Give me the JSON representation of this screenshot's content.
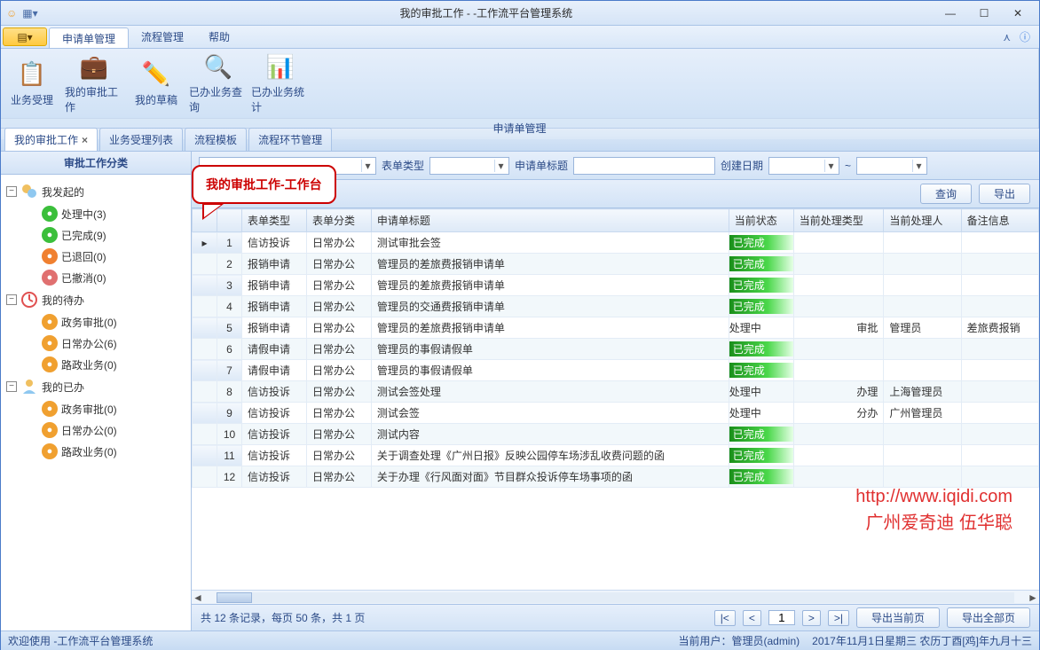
{
  "window": {
    "title": "我的审批工作 - -工作流平台管理系统"
  },
  "menu": {
    "file_icon": "▤▾",
    "items": [
      "申请单管理",
      "流程管理",
      "帮助"
    ],
    "active": 0
  },
  "ribbon": {
    "group_label": "申请单管理",
    "items": [
      "业务受理",
      "我的审批工作",
      "我的草稿",
      "已办业务查询",
      "已办业务统计"
    ]
  },
  "doc_tabs": [
    {
      "label": "我的审批工作",
      "active": true,
      "closable": true
    },
    {
      "label": "业务受理列表",
      "active": false
    },
    {
      "label": "流程模板",
      "active": false
    },
    {
      "label": "流程环节管理",
      "active": false
    }
  ],
  "sidebar": {
    "title": "审批工作分类",
    "groups": [
      {
        "label": "我发起的",
        "children": [
          {
            "label": "处理中(3)",
            "icon": "refresh",
            "color": "#3bbf3b"
          },
          {
            "label": "已完成(9)",
            "icon": "check",
            "color": "#3bbf3b"
          },
          {
            "label": "已退回(0)",
            "icon": "back",
            "color": "#f08030"
          },
          {
            "label": "已撤消(0)",
            "icon": "undo",
            "color": "#e07070"
          }
        ]
      },
      {
        "label": "我的待办",
        "children": [
          {
            "label": "政务审批(0)",
            "icon": "palette",
            "color": "#f0a030"
          },
          {
            "label": "日常办公(6)",
            "icon": "mail",
            "color": "#f0a030"
          },
          {
            "label": "路政业务(0)",
            "icon": "disc",
            "color": "#f0a030"
          }
        ]
      },
      {
        "label": "我的已办",
        "children": [
          {
            "label": "政务审批(0)",
            "icon": "palette",
            "color": "#f0a030"
          },
          {
            "label": "日常办公(0)",
            "icon": "mail",
            "color": "#f0a030"
          },
          {
            "label": "路政业务(0)",
            "icon": "disc",
            "color": "#f0a030"
          }
        ]
      }
    ]
  },
  "callout": "我的审批工作-工作台",
  "filters": {
    "f1_label": "表单类型",
    "f2_label": "申请单标题",
    "f3_label": "创建日期",
    "range_sep": "~"
  },
  "actions": {
    "query": "查询",
    "export": "导出"
  },
  "grid": {
    "columns": [
      "表单类型",
      "表单分类",
      "申请单标题",
      "当前状态",
      "当前处理类型",
      "当前处理人",
      "备注信息"
    ],
    "rows": [
      {
        "n": 1,
        "type": "信访投诉",
        "cat": "日常办公",
        "title": "测试审批会签",
        "status": "已完成",
        "ptype": "",
        "handler": "",
        "remark": ""
      },
      {
        "n": 2,
        "type": "报销申请",
        "cat": "日常办公",
        "title": "管理员的差旅费报销申请单",
        "status": "已完成",
        "ptype": "",
        "handler": "",
        "remark": ""
      },
      {
        "n": 3,
        "type": "报销申请",
        "cat": "日常办公",
        "title": "管理员的差旅费报销申请单",
        "status": "已完成",
        "ptype": "",
        "handler": "",
        "remark": ""
      },
      {
        "n": 4,
        "type": "报销申请",
        "cat": "日常办公",
        "title": "管理员的交通费报销申请单",
        "status": "已完成",
        "ptype": "",
        "handler": "",
        "remark": ""
      },
      {
        "n": 5,
        "type": "报销申请",
        "cat": "日常办公",
        "title": "管理员的差旅费报销申请单",
        "status": "处理中",
        "ptype": "审批",
        "handler": "管理员",
        "remark": "差旅费报销"
      },
      {
        "n": 6,
        "type": "请假申请",
        "cat": "日常办公",
        "title": "管理员的事假请假单",
        "status": "已完成",
        "ptype": "",
        "handler": "",
        "remark": ""
      },
      {
        "n": 7,
        "type": "请假申请",
        "cat": "日常办公",
        "title": "管理员的事假请假单",
        "status": "已完成",
        "ptype": "",
        "handler": "",
        "remark": ""
      },
      {
        "n": 8,
        "type": "信访投诉",
        "cat": "日常办公",
        "title": "测试会签处理",
        "status": "处理中",
        "ptype": "办理",
        "handler": "上海管理员",
        "remark": ""
      },
      {
        "n": 9,
        "type": "信访投诉",
        "cat": "日常办公",
        "title": "测试会签",
        "status": "处理中",
        "ptype": "分办",
        "handler": "广州管理员",
        "remark": ""
      },
      {
        "n": 10,
        "type": "信访投诉",
        "cat": "日常办公",
        "title": "测试内容",
        "status": "已完成",
        "ptype": "",
        "handler": "",
        "remark": ""
      },
      {
        "n": 11,
        "type": "信访投诉",
        "cat": "日常办公",
        "title": "关于调查处理《广州日报》反映公园停车场涉乱收费问题的函",
        "status": "已完成",
        "ptype": "",
        "handler": "",
        "remark": ""
      },
      {
        "n": 12,
        "type": "信访投诉",
        "cat": "日常办公",
        "title": "关于办理《行风面对面》节目群众投诉停车场事项的函",
        "status": "已完成",
        "ptype": "",
        "handler": "",
        "remark": ""
      }
    ]
  },
  "pager": {
    "summary": "共 12 条记录，每页 50 条，共 1 页",
    "first": "|<",
    "prev": "<",
    "page": "1",
    "next": ">",
    "last": ">|",
    "export_page": "导出当前页",
    "export_all": "导出全部页"
  },
  "watermark": {
    "l1": "http://www.iqidi.com",
    "l2": "广州爱奇迪 伍华聪"
  },
  "statusbar": {
    "left": "欢迎使用 -工作流平台管理系统",
    "user": "当前用户：管理员(admin)",
    "date": "2017年11月1日星期三 农历丁酉[鸡]年九月十三"
  }
}
